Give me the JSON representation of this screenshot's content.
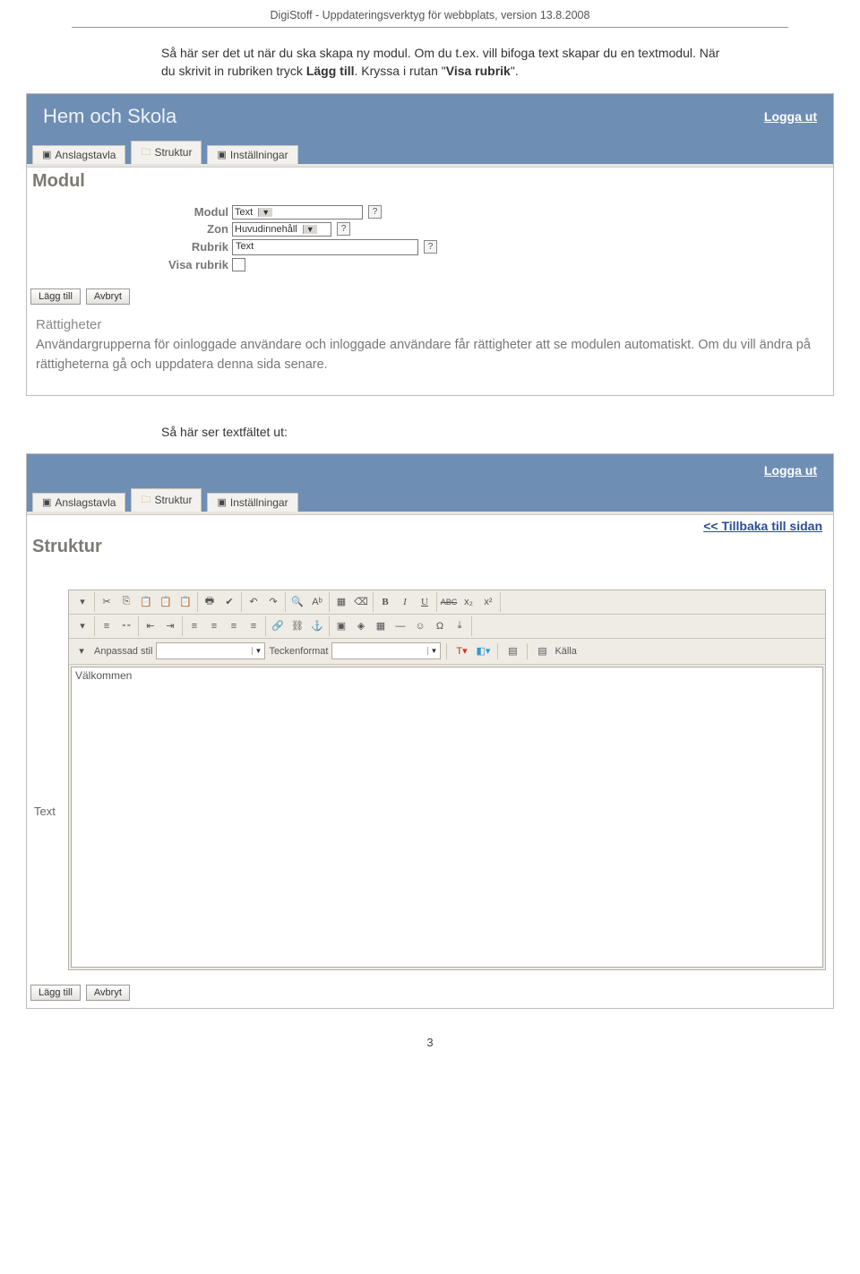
{
  "doc_header": "DigiStoff - Uppdateringsverktyg för webbplats, version 13.8.2008",
  "intro": {
    "p1a": "Så här ser det ut när du ska skapa ny modul. Om du t.ex. vill bifoga text skapar du en textmodul. När du skrivit in rubriken tryck ",
    "p1b": "Lägg till",
    "p1c": ". Kryssa i rutan \"",
    "p1d": "Visa rubrik",
    "p1e": "\"."
  },
  "screenshot1": {
    "app_title": "Hem och Skola",
    "logout": "Logga ut",
    "tabs": [
      "Anslagstavla",
      "Struktur",
      "Inställningar"
    ],
    "section_title": "Modul",
    "form": {
      "module_label": "Modul",
      "module_value": "Text",
      "zone_label": "Zon",
      "zone_value": "Huvudinnehåll",
      "heading_label": "Rubrik",
      "heading_value": "Text",
      "show_heading_label": "Visa rubrik"
    },
    "buttons": {
      "add": "Lägg till",
      "cancel": "Avbryt"
    },
    "rights_title": "Rättigheter",
    "rights_text": "Användargrupperna för oinloggade användare och inloggade användare får rättigheter att se modulen automatiskt. Om du vill ändra på rättigheterna gå och uppdatera denna sida senare."
  },
  "mid_text": "Så här ser textfältet ut:",
  "screenshot2": {
    "logout": "Logga ut",
    "tabs": [
      "Anslagstavla",
      "Struktur",
      "Inställningar"
    ],
    "back_link": "<< Tillbaka till sidan",
    "section_title": "Struktur",
    "side_label": "Text",
    "style_label": "Anpassad stil",
    "format_label": "Teckenformat",
    "source_label": "Källa",
    "editor_text": "Välkommen",
    "buttons": {
      "add": "Lägg till",
      "cancel": "Avbryt"
    }
  },
  "page_number": "3",
  "icons": {
    "help": "?",
    "bold": "B",
    "italic": "I",
    "underline": "U",
    "strike": "ABC",
    "sub": "x₂",
    "sup": "x²"
  }
}
